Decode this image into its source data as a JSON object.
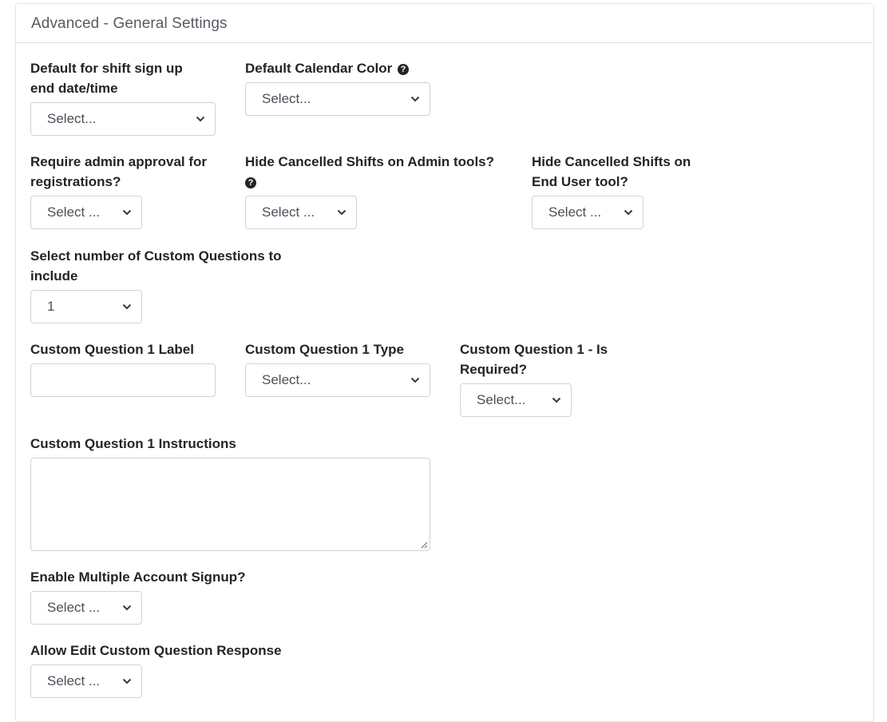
{
  "card": {
    "title": "Advanced - General Settings"
  },
  "fields": {
    "shift_end": {
      "label_line1": "Default for shift sign up",
      "label_line2": "end date/time",
      "value": "Select..."
    },
    "calendar_color": {
      "label": "Default Calendar Color",
      "value": "Select..."
    },
    "admin_approval": {
      "label_line1": "Require admin approval for",
      "label_line2": "registrations?",
      "value": "Select ..."
    },
    "hide_admin": {
      "label": "Hide Cancelled Shifts on Admin tools?",
      "value": "Select ..."
    },
    "hide_enduser": {
      "label_line1": "Hide Cancelled Shifts on",
      "label_line2": "End User tool?",
      "value": "Select ..."
    },
    "num_questions": {
      "label_line1": "Select number of Custom Questions to",
      "label_line2": "include",
      "value": "1"
    },
    "cq1_label": {
      "label": "Custom Question 1 Label",
      "value": ""
    },
    "cq1_type": {
      "label": "Custom Question 1 Type",
      "value": "Select..."
    },
    "cq1_required": {
      "label_line1": "Custom Question 1 - Is",
      "label_line2": "Required?",
      "value": "Select..."
    },
    "cq1_instructions": {
      "label": "Custom Question 1 Instructions",
      "value": ""
    },
    "multi_account": {
      "label": "Enable Multiple Account Signup?",
      "value": "Select ..."
    },
    "allow_edit": {
      "label": "Allow Edit Custom Question Response",
      "value": "Select ..."
    }
  },
  "icons": {
    "help": "question-circle-icon",
    "dropdown": "chevron-down-icon",
    "resize": "resize-grip-icon"
  }
}
